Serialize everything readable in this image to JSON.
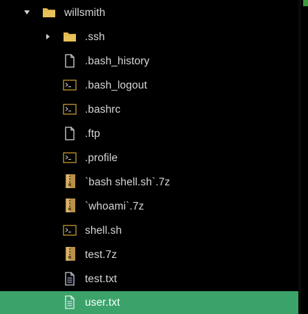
{
  "explorer": {
    "root": {
      "label": "willsmith",
      "expanded": true
    },
    "items": [
      {
        "label": ".ssh",
        "type": "folder",
        "icon": "folder-icon"
      },
      {
        "label": ".bash_history",
        "type": "file",
        "icon": "file-icon"
      },
      {
        "label": ".bash_logout",
        "type": "shell",
        "icon": "terminal-file-icon"
      },
      {
        "label": ".bashrc",
        "type": "shell",
        "icon": "terminal-file-icon"
      },
      {
        "label": ".ftp",
        "type": "file",
        "icon": "file-icon"
      },
      {
        "label": ".profile",
        "type": "shell",
        "icon": "terminal-file-icon"
      },
      {
        "label": "`bash shell.sh`.7z",
        "type": "archive",
        "icon": "archive-icon"
      },
      {
        "label": "`whoami`.7z",
        "type": "archive",
        "icon": "archive-icon"
      },
      {
        "label": "shell.sh",
        "type": "shell",
        "icon": "terminal-file-icon"
      },
      {
        "label": "test.7z",
        "type": "archive",
        "icon": "archive-icon"
      },
      {
        "label": "test.txt",
        "type": "text",
        "icon": "text-file-icon"
      },
      {
        "label": "user.txt",
        "type": "text",
        "icon": "text-file-icon",
        "selected": true
      }
    ],
    "selected_color": "#3ba36a",
    "folder_color": "#e8c15a",
    "archive_color": "#c49a4a",
    "terminal_color": "#c99a2e"
  }
}
